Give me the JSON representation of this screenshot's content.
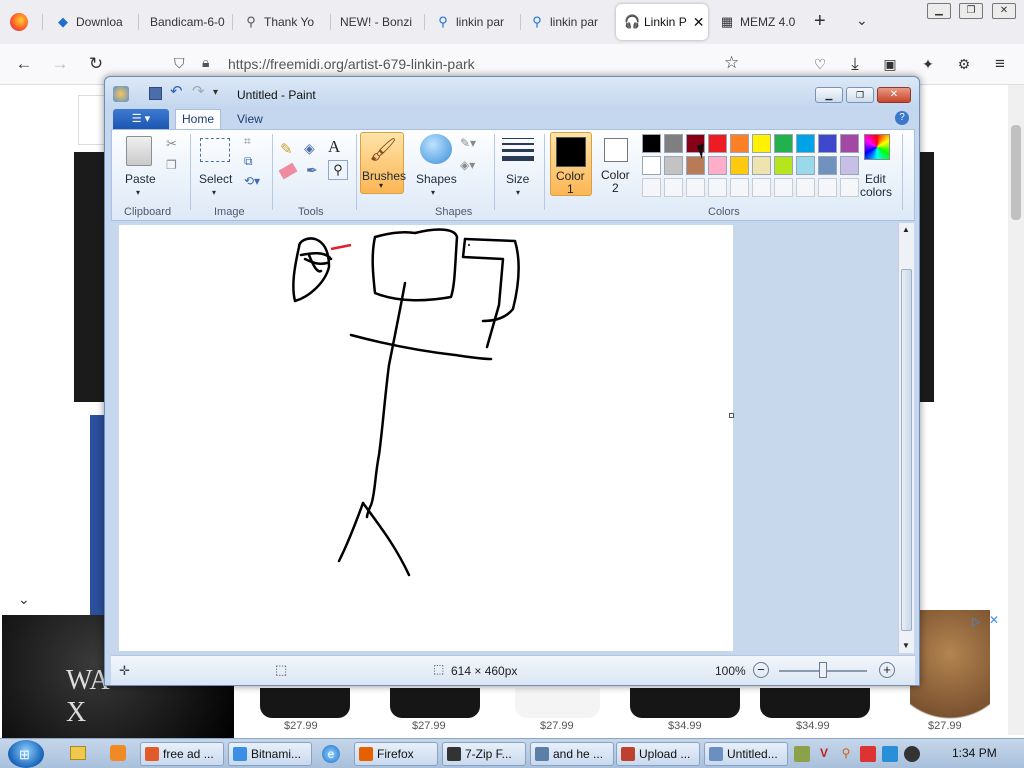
{
  "browser": {
    "tabs": [
      {
        "label": "Downloa",
        "icon": "download-icon"
      },
      {
        "label": "Bandicam-6-0",
        "icon": "none"
      },
      {
        "label": "Thank Yo",
        "icon": "search-icon"
      },
      {
        "label": "NEW! - Bonzi",
        "icon": "none"
      },
      {
        "label": "linkin par",
        "icon": "search-icon"
      },
      {
        "label": "linkin par",
        "icon": "search-icon"
      },
      {
        "label": "Linkin P",
        "icon": "headphones-icon",
        "active": true
      },
      {
        "label": "MEMZ 4.0",
        "icon": "page-icon"
      }
    ],
    "url": "https://freemidi.org/artist-679-linkin-park",
    "prices": [
      "$27.99",
      "$27.99",
      "$27.99",
      "$34.99",
      "$34.99",
      "$27.99"
    ]
  },
  "paint": {
    "title": "Untitled - Paint",
    "tabs": {
      "home": "Home",
      "view": "View"
    },
    "groups": {
      "clipboard": "Clipboard",
      "image": "Image",
      "tools": "Tools",
      "shapes": "Shapes",
      "colors": "Colors"
    },
    "buttons": {
      "paste": "Paste",
      "select": "Select",
      "brushes": "Brushes",
      "shapes": "Shapes",
      "size": "Size",
      "color1_a": "Color",
      "color1_b": "1",
      "color2_a": "Color",
      "color2_b": "2",
      "edit_a": "Edit",
      "edit_b": "colors"
    },
    "palette_row1": [
      "#000000",
      "#7f7f7f",
      "#880015",
      "#ed1c24",
      "#ff7f27",
      "#fff200",
      "#22b14c",
      "#00a2e8",
      "#3f48cc",
      "#a349a4"
    ],
    "palette_row2": [
      "#ffffff",
      "#c3c3c3",
      "#b97a57",
      "#ffaec9",
      "#ffc90e",
      "#efe4b0",
      "#b5e61d",
      "#99d9ea",
      "#7092be",
      "#c8bfe7"
    ],
    "color1": "#000000",
    "color2": "#ffffff",
    "status": {
      "size": "614 × 460px",
      "zoom": "100%"
    }
  },
  "taskbar": {
    "items": [
      {
        "label": "free ad ...",
        "color": "#e05a2a"
      },
      {
        "label": "Bitnami...",
        "color": "#3a8ee6"
      },
      {
        "label": "Firefox",
        "color": "#e66000"
      },
      {
        "label": "7-Zip F...",
        "color": "#333333"
      },
      {
        "label": "and he ...",
        "color": "#5c7fa8"
      },
      {
        "label": "Upload ...",
        "color": "#c04030"
      },
      {
        "label": "Untitled...",
        "color": "#6a8fc0"
      }
    ],
    "clock": "1:34 PM"
  }
}
